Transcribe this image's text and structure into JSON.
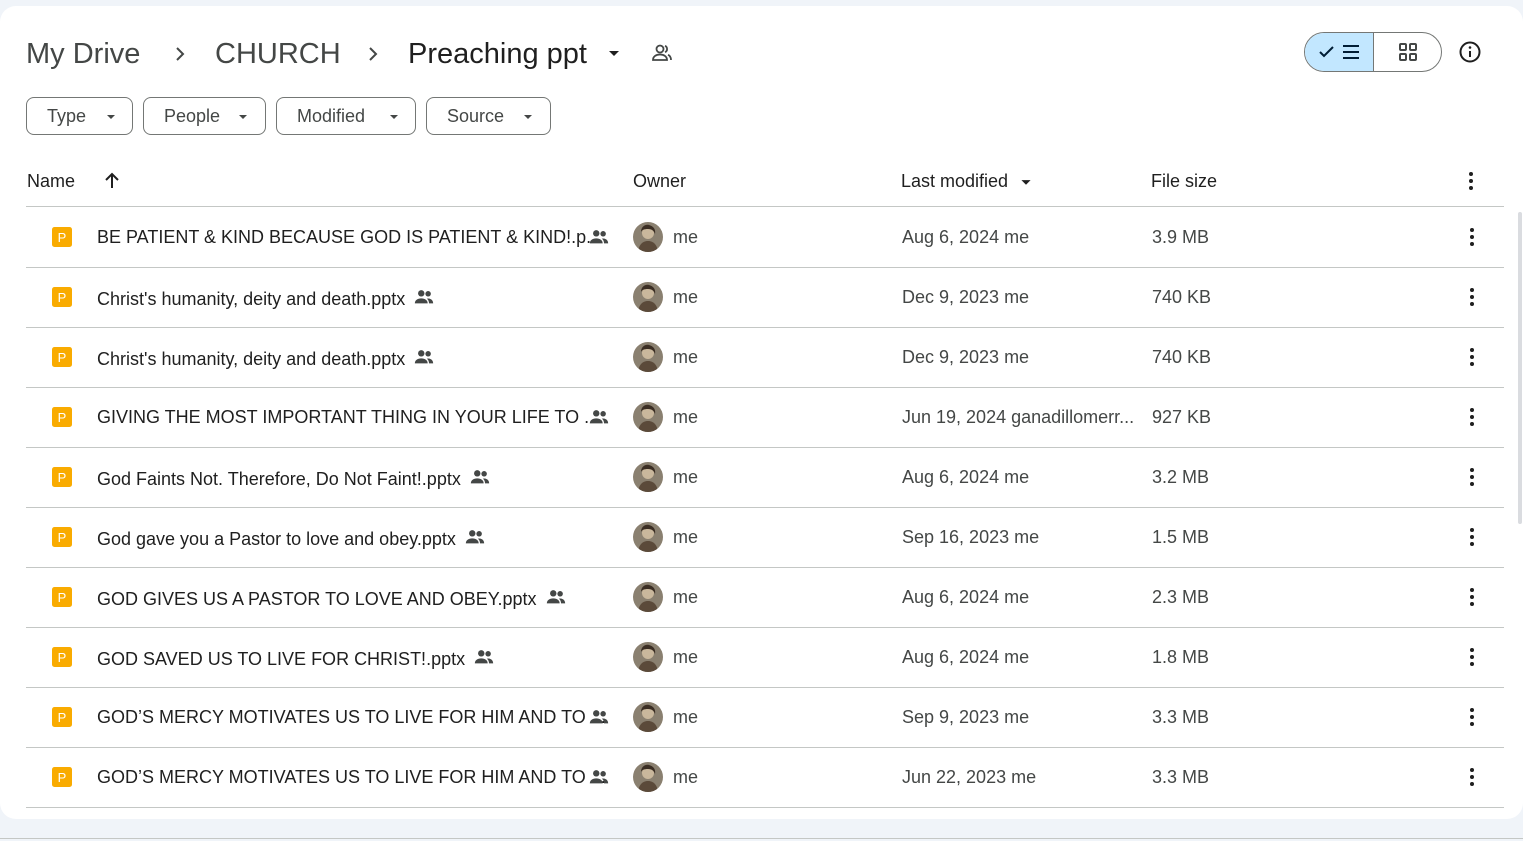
{
  "breadcrumb": {
    "items": [
      "My Drive",
      "CHURCH",
      "Preaching ppt"
    ]
  },
  "filters": [
    {
      "label": "Type"
    },
    {
      "label": "People"
    },
    {
      "label": "Modified"
    },
    {
      "label": "Source"
    }
  ],
  "table": {
    "columns": {
      "name": "Name",
      "owner": "Owner",
      "modified": "Last modified",
      "size": "File size"
    },
    "rows": [
      {
        "name": "BE PATIENT & KIND BECAUSE GOD IS PATIENT & KIND!.p...",
        "owner": "me",
        "modified": "Aug 6, 2024 me",
        "size": "3.9 MB"
      },
      {
        "name": "Christ's humanity, deity and death.pptx",
        "owner": "me",
        "modified": "Dec 9, 2023 me",
        "size": "740 KB"
      },
      {
        "name": "Christ's humanity, deity and death.pptx",
        "owner": "me",
        "modified": "Dec 9, 2023 me",
        "size": "740 KB"
      },
      {
        "name": "GIVING THE MOST IMPORTANT THING IN YOUR LIFE TO ...",
        "owner": "me",
        "modified": "Jun 19, 2024 ganadillomerr...",
        "size": "927 KB"
      },
      {
        "name": "God Faints Not. Therefore, Do Not Faint!.pptx",
        "owner": "me",
        "modified": "Aug 6, 2024 me",
        "size": "3.2 MB"
      },
      {
        "name": "God gave you a Pastor to love and obey.pptx",
        "owner": "me",
        "modified": "Sep 16, 2023 me",
        "size": "1.5 MB"
      },
      {
        "name": "GOD GIVES US A PASTOR TO LOVE AND OBEY.pptx",
        "owner": "me",
        "modified": "Aug 6, 2024 me",
        "size": "2.3 MB"
      },
      {
        "name": "GOD SAVED US TO LIVE FOR CHRIST!.pptx",
        "owner": "me",
        "modified": "Aug 6, 2024 me",
        "size": "1.8 MB"
      },
      {
        "name": "GOD’S MERCY MOTIVATES US TO LIVE FOR HIM AND TO ...",
        "owner": "me",
        "modified": "Sep 9, 2023 me",
        "size": "3.3 MB"
      },
      {
        "name": "GOD’S MERCY MOTIVATES US TO LIVE FOR HIM AND TO ...",
        "owner": "me",
        "modified": "Jun 22, 2023 me",
        "size": "3.3 MB"
      }
    ]
  },
  "icons": {
    "file_type": "slides-file-icon",
    "file_badge_letter": "P",
    "file_color": "#f9ab00",
    "accent_color": "#c2e7ff"
  }
}
